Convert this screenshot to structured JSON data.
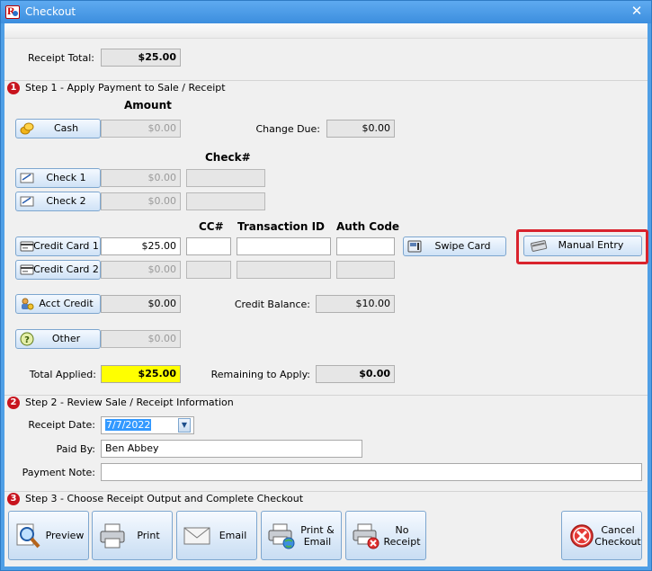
{
  "window": {
    "title": "Checkout",
    "close_glyph": "✕"
  },
  "receipt_total": {
    "label": "Receipt Total:",
    "value": "$25.00"
  },
  "step1": {
    "num": "1",
    "title": "Step 1 - Apply Payment to Sale / Receipt",
    "amount_header": "Amount",
    "check_header": "Check#",
    "cc_header": "CC#",
    "txn_header": "Transaction ID",
    "auth_header": "Auth Code",
    "cash": {
      "label": "Cash",
      "amount": "$0.00"
    },
    "change_due": {
      "label": "Change Due:",
      "value": "$0.00"
    },
    "check1": {
      "label": "Check 1",
      "amount": "$0.00",
      "number": ""
    },
    "check2": {
      "label": "Check 2",
      "amount": "$0.00",
      "number": ""
    },
    "cc1": {
      "label": "Credit Card 1",
      "amount": "$25.00",
      "cc": "",
      "txn": "",
      "auth": ""
    },
    "cc2": {
      "label": "Credit Card 2",
      "amount": "$0.00",
      "cc": "",
      "txn": "",
      "auth": ""
    },
    "swipe_card": "Swipe Card",
    "manual_entry": "Manual Entry",
    "acct_credit": {
      "label": "Acct Credit",
      "amount": "$0.00"
    },
    "credit_balance": {
      "label": "Credit Balance:",
      "value": "$10.00"
    },
    "other": {
      "label": "Other",
      "amount": "$0.00"
    },
    "total_applied": {
      "label": "Total Applied:",
      "value": "$25.00"
    },
    "remaining": {
      "label": "Remaining to Apply:",
      "value": "$0.00"
    }
  },
  "step2": {
    "num": "2",
    "title": "Step 2 - Review Sale / Receipt Information",
    "receipt_date": {
      "label": "Receipt Date:",
      "value": "7/7/2022"
    },
    "paid_by": {
      "label": "Paid By:",
      "value": "Ben Abbey"
    },
    "payment_note": {
      "label": "Payment Note:",
      "value": ""
    }
  },
  "step3": {
    "num": "3",
    "title": "Step 3 - Choose Receipt Output and Complete Checkout",
    "buttons": {
      "preview": "Preview",
      "print": "Print",
      "email": "Email",
      "print_email": "Print &\nEmail",
      "no_receipt": "No\nReceipt",
      "cancel": "Cancel\nCheckout"
    }
  },
  "icons": {
    "app": "app-logo-icon",
    "cash": "coins-icon",
    "check": "check-pen-icon",
    "card": "credit-card-icon",
    "swipe": "card-reader-icon",
    "manual": "card-hand-icon",
    "acct": "account-credit-icon",
    "other": "question-icon",
    "preview": "magnifier-document-icon",
    "print": "printer-icon",
    "email": "envelope-icon",
    "print_email": "printer-globe-icon",
    "no_receipt": "printer-no-icon",
    "cancel": "cancel-circle-icon"
  },
  "colors": {
    "title_bar": "#3c8ede",
    "highlight": "#d9232d",
    "total_applied_bg": "#ffff00",
    "step_badge": "#c8141e"
  }
}
